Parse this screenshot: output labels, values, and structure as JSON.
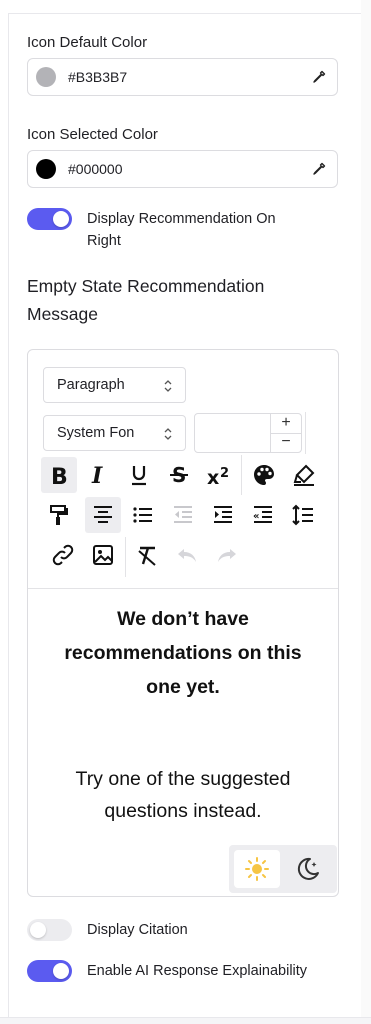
{
  "icon_default_color": {
    "label": "Icon Default Color",
    "value": "#B3B3B7",
    "swatch": "#B3B3B7"
  },
  "icon_selected_color": {
    "label": "Icon Selected Color",
    "value": "#000000",
    "swatch": "#000000"
  },
  "toggles": {
    "display_recommendation_right": {
      "label_line1": "Display Recommendation On",
      "label_line2": "Right",
      "on": true
    },
    "display_citation": {
      "label": "Display Citation",
      "on": false
    },
    "enable_ai_explainability": {
      "label": "Enable AI Response Explainability",
      "on": true
    }
  },
  "empty_state": {
    "title_line1": "Empty State Recommendation",
    "title_line2": "Message",
    "editor": {
      "block_format": "Paragraph",
      "font_family": "System Fon",
      "font_size": "",
      "message_bold_line1": "We don’t have",
      "message_bold_line2": "recommendations on this",
      "message_bold_line3": "one yet.",
      "message_line1": "Try one of the suggested",
      "message_line2": "questions instead.",
      "toolbar_icons": [
        "bold-icon",
        "italic-icon",
        "underline-icon",
        "strikethrough-icon",
        "superscript-icon",
        "text-color-icon",
        "highlight-icon",
        "format-painter-icon",
        "align-center-icon",
        "bullet-list-icon",
        "outdent-icon",
        "indent-icon",
        "blockquote-icon",
        "line-height-icon",
        "link-icon",
        "image-icon",
        "clear-formatting-icon",
        "undo-icon",
        "redo-icon"
      ],
      "theme": "light"
    }
  },
  "colors": {
    "accent": "#5b5bf0",
    "toggle_off": "#ececef"
  }
}
